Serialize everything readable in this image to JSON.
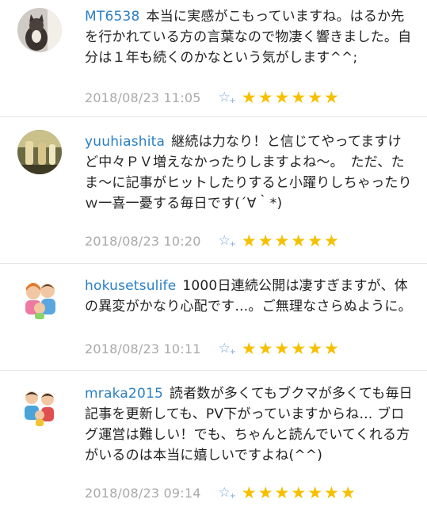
{
  "colors": {
    "username": "#2a7fc4",
    "star": "#f6c000",
    "timestamp": "#a9a9a9",
    "add_star": "#7fa8d6"
  },
  "icons": {
    "add_star": "add-star-icon",
    "star": "star-icon"
  },
  "comments": [
    {
      "user": "MT6538",
      "text": "本当に実感がこもっていますね。はるか先を行かれている方の言葉なので物凄く響きました。自分は１年も続くのかなという気がします^^;",
      "time": "2018/08/23 11:05",
      "stars": 6
    },
    {
      "user": "yuuhiashita",
      "text": "継続は力なり！と信じてやってますけど中々ＰＶ増えなかったりしますよね〜。　ただ、たま〜に記事がヒットしたりすると小躍りしちゃったりｗ一喜一憂する毎日です(´∀｀*)",
      "time": "2018/08/23 10:20",
      "stars": 6
    },
    {
      "user": "hokusetsulife",
      "text": "1000日連続公開は凄すぎますが、体の異変がかなり心配です…。ご無理なさらぬように。",
      "time": "2018/08/23 10:11",
      "stars": 6
    },
    {
      "user": "mraka2015",
      "text": "読者数が多くてもブクマが多くても毎日記事を更新しても、PV下がっていますからね… ブログ運営は難しい！でも、ちゃんと読んでいてくれる方がいるのは本当に嬉しいですよね(^^)",
      "time": "2018/08/23 09:14",
      "stars": 7
    }
  ]
}
